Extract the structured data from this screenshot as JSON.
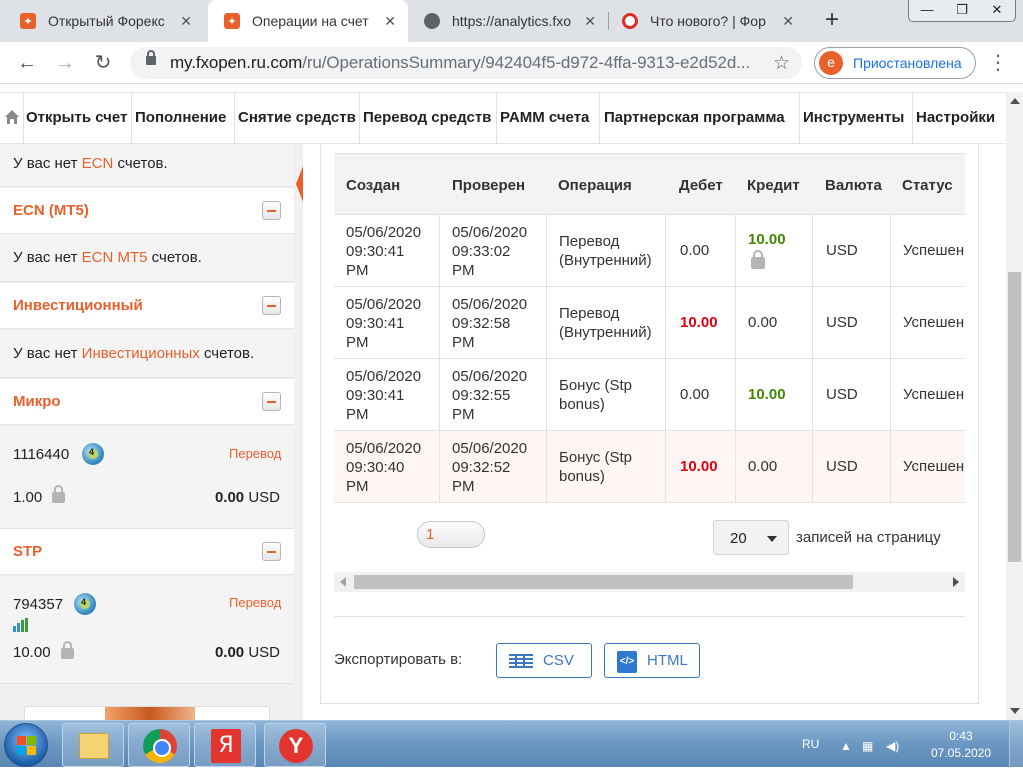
{
  "browser": {
    "tabs": [
      {
        "title": "Открытый Форекс",
        "active": false,
        "favicon": "fxopen-icon"
      },
      {
        "title": "Операции на счет",
        "active": true,
        "favicon": "fxopen-icon"
      },
      {
        "title": "https://analytics.fxo",
        "active": false,
        "favicon": "globe-icon"
      },
      {
        "title": "Что нового? | Фор",
        "active": false,
        "favicon": "lifebuoy-icon"
      }
    ],
    "new_tab_glyph": "+",
    "url_host": "my.fxopen.ru.com",
    "url_path": "/ru/OperationsSummary/942404f5-d972-4ffa-9313-e2d52d...",
    "profile_initial": "e",
    "profile_label": "Приостановлена"
  },
  "site_nav": {
    "items": [
      "Открыть счет",
      "Пополнение",
      "Снятие средств",
      "Перевод средств",
      "PAMM счета",
      "Партнерская программа",
      "Инструменты",
      "Настройки"
    ]
  },
  "sidebar": {
    "ecn_note": {
      "prefix": "У вас нет ",
      "link": "ECN",
      "suffix": " счетов."
    },
    "ecn_mt5": {
      "title": "ECN (MT5)",
      "prefix": "У вас нет ",
      "link": "ECN MT5",
      "suffix": " счетов."
    },
    "investment": {
      "title": "Инвестиционный",
      "prefix": "У вас нет ",
      "link": "Инвестиционных",
      "suffix": " счетов."
    },
    "micro": {
      "title": "Микро",
      "account": "1116440",
      "platform_badge": "4",
      "action": "Перевод",
      "balance": "1.00",
      "equity": "0.00",
      "currency": "USD"
    },
    "stp": {
      "title": "STP",
      "account": "794357",
      "platform_badge": "4",
      "action": "Перевод",
      "balance": "10.00",
      "equity": "0.00",
      "currency": "USD"
    }
  },
  "operations": {
    "columns": [
      "Создан",
      "Проверен",
      "Операция",
      "Дебет",
      "Кредит",
      "Валюта",
      "Статус"
    ],
    "rows": [
      {
        "created": "05/06/2020\n09:30:41\nPM",
        "checked": "05/06/2020\n09:33:02\nPM",
        "operation": "Перевод\n(Внутренний)",
        "debit": "0.00",
        "credit": "10.00",
        "currency": "USD",
        "status": "Успешен",
        "debit_style": "plain",
        "credit_style": "green",
        "credit_locked": true
      },
      {
        "created": "05/06/2020\n09:30:41\nPM",
        "checked": "05/06/2020\n09:32:58\nPM",
        "operation": "Перевод\n(Внутренний)",
        "debit": "10.00",
        "credit": "0.00",
        "currency": "USD",
        "status": "Успешен",
        "debit_style": "red",
        "credit_style": "plain",
        "credit_locked": false
      },
      {
        "created": "05/06/2020\n09:30:41\nPM",
        "checked": "05/06/2020\n09:32:55\nPM",
        "operation": "Бонус (Stp\nbonus)",
        "debit": "0.00",
        "credit": "10.00",
        "currency": "USD",
        "status": "Успешен",
        "debit_style": "plain",
        "credit_style": "green",
        "credit_locked": false
      },
      {
        "created": "05/06/2020\n09:30:40\nPM",
        "checked": "05/06/2020\n09:32:52\nPM",
        "operation": "Бонус (Stp\nbonus)",
        "debit": "10.00",
        "credit": "0.00",
        "currency": "USD",
        "status": "Успешен",
        "debit_style": "red",
        "credit_style": "plain",
        "credit_locked": false
      }
    ],
    "current_page": "1",
    "per_page": "20",
    "per_page_label": "записей на страницу",
    "export_label": "Экспортировать в:",
    "export_csv": "CSV",
    "export_html": "HTML"
  },
  "taskbar": {
    "pinned": [
      "folder-icon",
      "chrome-icon",
      "yandex-icon",
      "yandex-browser-icon"
    ],
    "yandex_glyph": "Я",
    "yandex_browser_glyph": "Y",
    "lang": "RU",
    "time": "0:43",
    "date": "07.05.2020"
  },
  "colors": {
    "brand_orange": "#e8612c",
    "debit_red": "#e00012",
    "credit_green": "#3d8a00",
    "link_blue": "#3a78c2"
  }
}
